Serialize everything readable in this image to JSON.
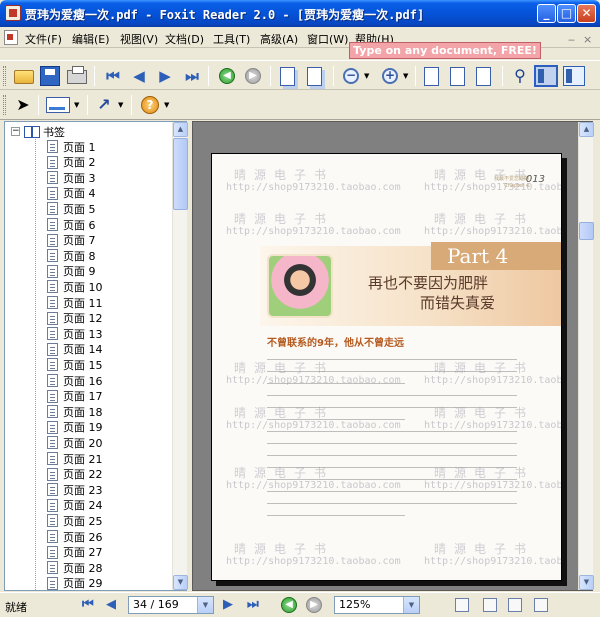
{
  "window": {
    "title": "贾玮为爱瘦一次.pdf - Foxit Reader 2.0 - [贾玮为爱瘦一次.pdf]"
  },
  "menu": {
    "items": [
      {
        "label": "文件(F)"
      },
      {
        "label": "编辑(E)"
      },
      {
        "label": "视图(V)"
      },
      {
        "label": "文档(D)"
      },
      {
        "label": "工具(T)"
      },
      {
        "label": "高级(A)"
      },
      {
        "label": "窗口(W)"
      },
      {
        "label": "帮助(H)"
      }
    ],
    "promo": "Type on any document, FREE!",
    "promo_close": "×",
    "promo_min": "‒"
  },
  "toolbar": {
    "nav_first": "⏮",
    "nav_prev": "◀",
    "nav_next": "▶",
    "nav_last": "⏭",
    "back": "◀",
    "forward": "▶",
    "zoom_out": "−",
    "zoom_in": "+",
    "find": "⚲",
    "help": "?",
    "select": "➤",
    "arrow": "↗"
  },
  "bookmarks": {
    "root": "书签",
    "items": [
      "页面 1",
      "页面 2",
      "页面 3",
      "页面 4",
      "页面 5",
      "页面 6",
      "页面 7",
      "页面 8",
      "页面 9",
      "页面 10",
      "页面 11",
      "页面 12",
      "页面 13",
      "页面 14",
      "页面 15",
      "页面 16",
      "页面 17",
      "页面 18",
      "页面 19",
      "页面 20",
      "页面 21",
      "页面 22",
      "页面 23",
      "页面 24",
      "页面 25",
      "页面 26",
      "页面 27",
      "页面 28",
      "页面 29"
    ]
  },
  "page": {
    "watermark_cn": "晴源电子书",
    "watermark_url": "http://shop9173210.taobao.com",
    "header_text": "我最不爱恋错的\nChapter 4",
    "page_number": "013",
    "part_label": "Part 4",
    "title_line1": "再也不要因为肥胖",
    "title_line2": "而错失真爱",
    "section_title": "不曾联系的9年，他从不曾走远"
  },
  "status": {
    "text": "就绪",
    "page_field": "34 / 169",
    "zoom_field": "125%"
  },
  "colors": {
    "title_bar": "#0553d8",
    "promo": "#f2a4a8",
    "part_box": "#d8aa78"
  }
}
